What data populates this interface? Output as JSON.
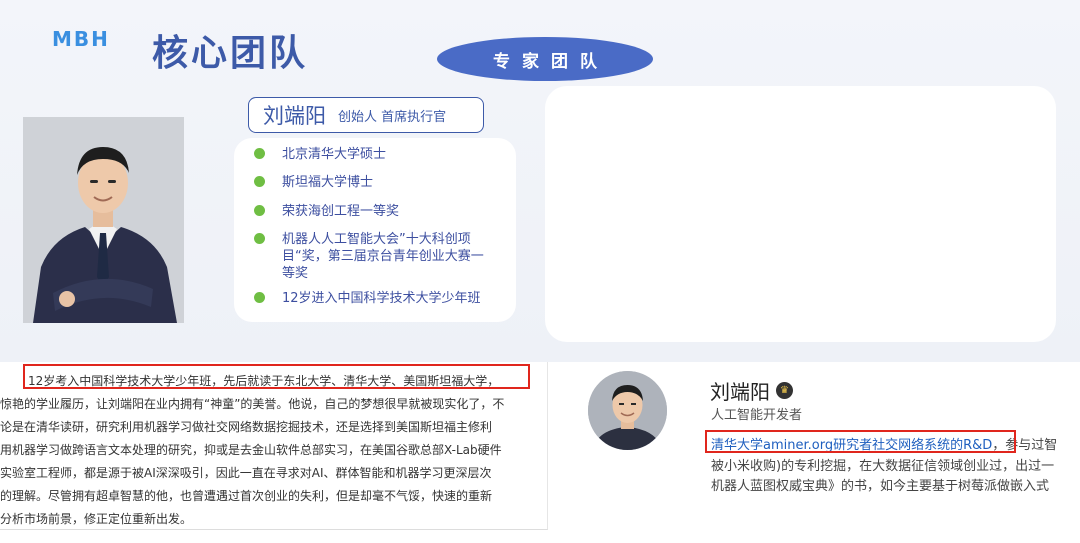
{
  "slide": {
    "logo": "MBH",
    "title": "核心团队",
    "team_label": "专家团队",
    "person": {
      "name": "刘端阳",
      "role": "创始人  首席执行官"
    },
    "bullets": [
      "北京清华大学硕士",
      "斯坦福大学博士",
      "荣获海创工程一等奖",
      "机器人人工智能大会”十大科创项目“奖，第三届京台青年创业大赛一等奖",
      "12岁进入中国科学技术大学少年班"
    ]
  },
  "article": {
    "lines": [
      "12岁考入中国科学技术大学少年班，先后就读于东北大学、清华大学、美国斯坦福大学，",
      "惊艳的学业履历，让刘端阳在业内拥有“神童”的美誉。他说，自己的梦想很早就被现实化了，不",
      "论是在清华读研，研究利用机器学习做社交网络数据挖掘技术，还是选择到美国斯坦福主修利",
      "用机器学习做跨语言文本处理的研究，抑或是去金山软件总部实习，在美国谷歌总部X-Lab硬件",
      "实验室工程师，都是源于被AI深深吸引，因此一直在寻求对AI、群体智能和机器学习更深层次",
      "的理解。尽管拥有超卓智慧的他，也曾遭遇过首次创业的失利，但是却毫不气馁，快速的重新",
      "分析市场前景，修正定位重新出发。"
    ]
  },
  "profile": {
    "name": "刘端阳",
    "title": "人工智能开发者",
    "highlight": "清华大学aminer.org研究者社交网络系统的R&D",
    "line1_rest": "，参与过智",
    "line2": "被小米收购)的专利挖掘，在大数据征信领域创业过，出过一",
    "line3": "机器人蓝图权威宝典》的书，如今主要基于树莓派做嵌入式"
  },
  "colors": {
    "brand_blue": "#3d5aa8",
    "pill_blue": "#4a6bc6",
    "bullet_green": "#6fbe43",
    "highlight_red": "#e0261d",
    "logo_blue": "#3a8fe0"
  }
}
